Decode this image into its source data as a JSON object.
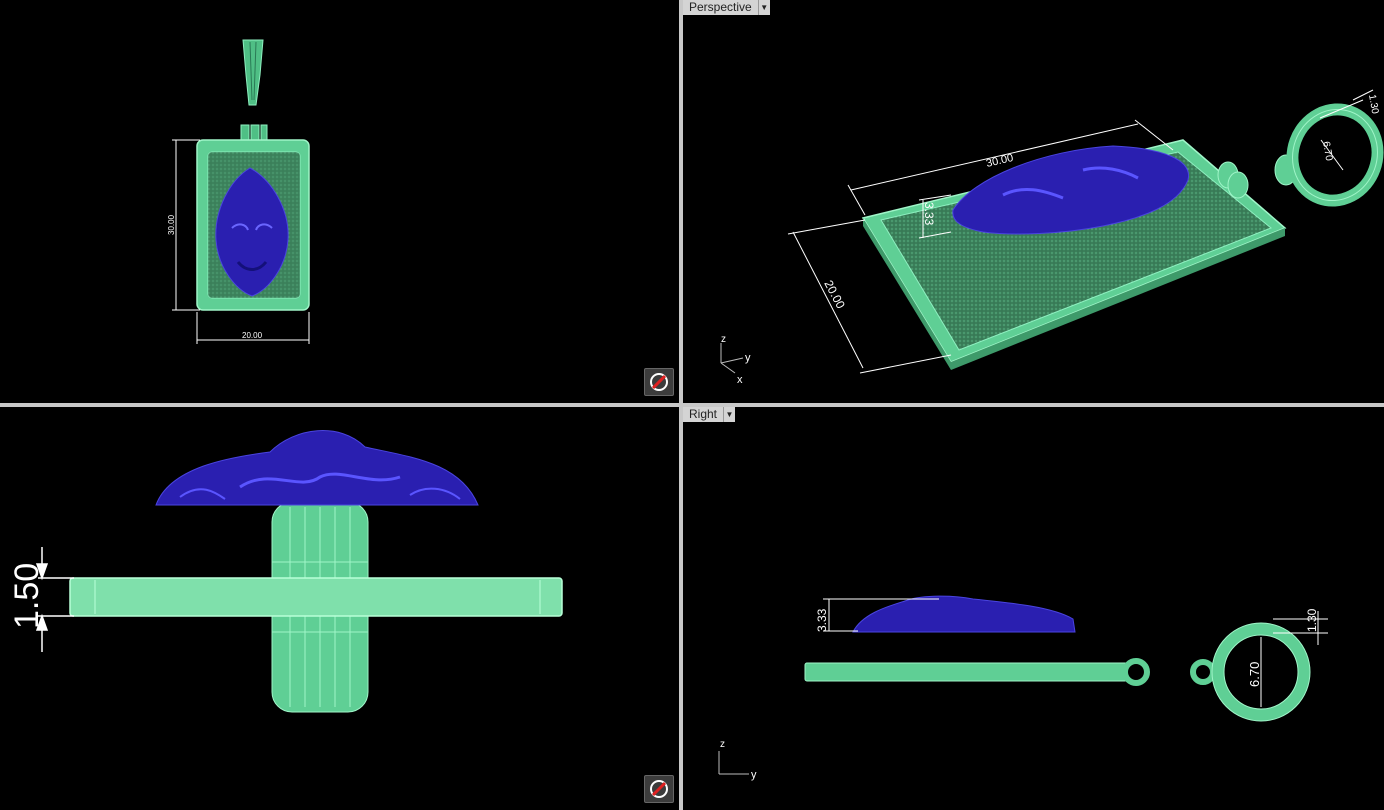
{
  "viewports": {
    "top": {
      "dimensions": {
        "height": "30.00",
        "width": "20.00"
      }
    },
    "perspective": {
      "label": "Perspective",
      "dimensions": {
        "length": "30.00",
        "width": "20.00",
        "relief_height": "3.33",
        "ring_inner": "6.70",
        "ring_thickness": "1.30"
      },
      "axes": {
        "z": "z",
        "y": "y",
        "x": "x"
      }
    },
    "front": {
      "dimensions": {
        "thickness": "1.50"
      }
    },
    "right": {
      "label": "Right",
      "dimensions": {
        "relief_height": "3.33",
        "ring_inner": "6.70",
        "ring_thickness": "1.30"
      },
      "axes": {
        "z": "z",
        "y": "y"
      }
    }
  },
  "colors": {
    "model_green": "#5fcf95",
    "model_blue": "#2a1fb0",
    "background": "#000000",
    "divider": "#c8c8c8"
  },
  "icons": {
    "navigation": "rotate-view-icon",
    "dropdown": "chevron-down-icon"
  }
}
